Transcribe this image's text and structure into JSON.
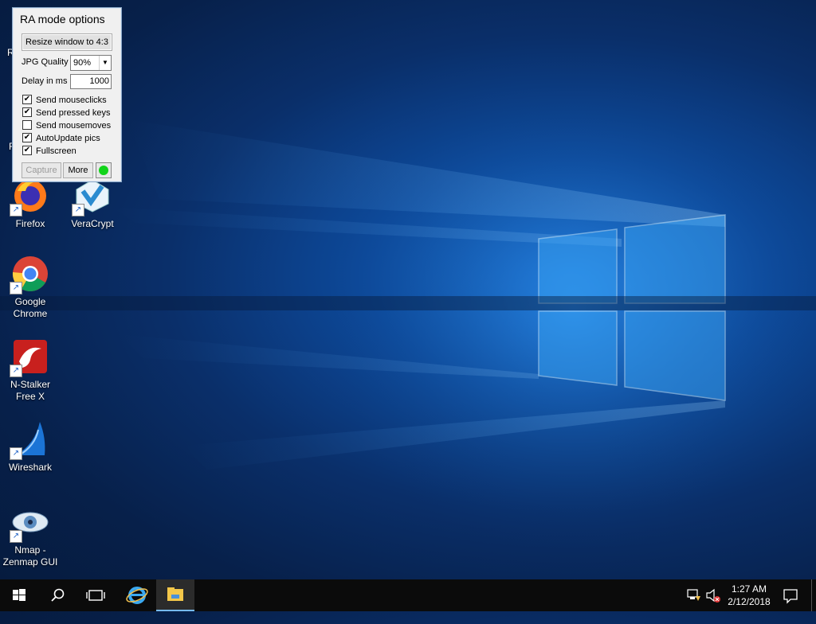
{
  "ra_panel": {
    "title": "RA mode options",
    "resize_button": "Resize window to 4:3",
    "jpg_quality_label": "JPG Quality",
    "jpg_quality_value": "90%",
    "delay_label": "Delay in ms",
    "delay_value": "1000",
    "checkboxes": [
      {
        "label": "Send mouseclicks",
        "checked": true
      },
      {
        "label": "Send pressed keys",
        "checked": true
      },
      {
        "label": "Send mousemoves",
        "checked": false
      },
      {
        "label": "AutoUpdate pics",
        "checked": true
      },
      {
        "label": "Fullscreen",
        "checked": true
      }
    ],
    "capture_button": "Capture",
    "more_button": "More",
    "status_color": "#12d41a"
  },
  "desktop": {
    "icons": [
      {
        "label": "Firefox",
        "icon": "firefox-icon"
      },
      {
        "label": "VeraCrypt",
        "icon": "veracrypt-icon"
      },
      {
        "label": "Google Chrome",
        "icon": "chrome-icon"
      },
      {
        "label": "N-Stalker Free X",
        "icon": "nstalker-icon"
      },
      {
        "label": "Wireshark",
        "icon": "wireshark-icon"
      },
      {
        "label": "Nmap - Zenmap GUI",
        "icon": "zenmap-icon"
      }
    ],
    "partial_left_letters": [
      "R",
      "R"
    ]
  },
  "taskbar": {
    "items": [
      "start-icon",
      "search-icon",
      "task-view-icon",
      "internet-explorer-icon",
      "file-explorer-icon"
    ],
    "clock": {
      "time": "1:27 AM",
      "date": "2/12/2018"
    }
  },
  "colors": {
    "taskbar_bg": "#0b0b0b",
    "accent": "#76b9ed"
  }
}
